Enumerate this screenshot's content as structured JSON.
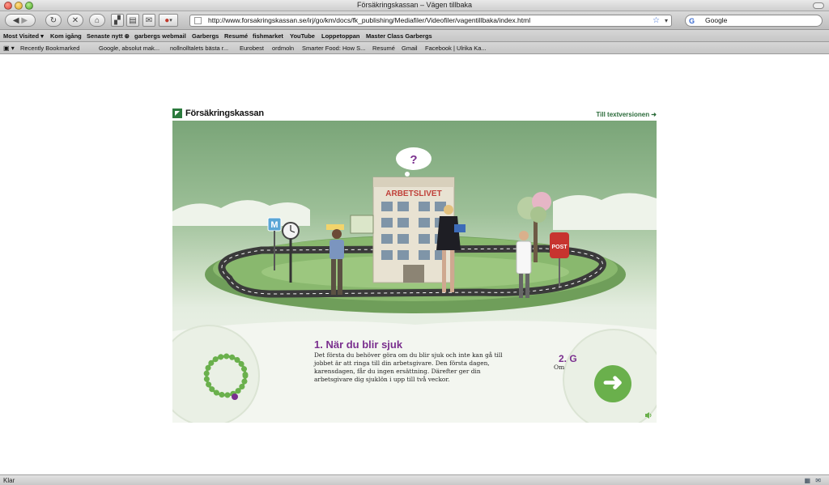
{
  "window": {
    "title": "Försäkringskassan – Vägen tillbaka"
  },
  "toolbar": {
    "url": "http://www.forsakringskassan.se/irj/go/km/docs/fk_publishing/Mediafiler/Videofiler/vagentillbaka/index.html",
    "search_value": "Google"
  },
  "bookmarks": {
    "row1": [
      "Most Visited ▾",
      "Kom igång",
      "Senaste nytt ⊛",
      "garbergs webmail",
      "Garbergs",
      "Resumé",
      "fishmarket",
      "YouTube",
      "Loppetoppan",
      "Master Class Garbergs"
    ],
    "row2": [
      "Recently Bookmarked",
      "Google, absolut mak...",
      "nollnolltalets bästa r...",
      "Eurobest",
      "ordmoln",
      "Smarter Food: How S...",
      "Resumé",
      "Gmail",
      "Facebook | Ulrika Ka..."
    ]
  },
  "page": {
    "logo_text": "Försäkringskassan",
    "text_version_link": "Till textversionen ➜",
    "scene": {
      "building_sign": "ARBETSLIVET",
      "thought_bubble": "?",
      "station_sign": "M",
      "mailbox_label": "POST"
    },
    "step": {
      "title": "1. När du blir sjuk",
      "body": "Det första du behöver göra om du blir sjuk och inte kan gå till jobbet är att ringa till din arbetsgivare. Den första dagen, karensdagen, får du ingen ersättning. Därefter ger din arbetsgivare dig sjuklön i upp till två veckor."
    },
    "next_step": {
      "title_fragment": "2. G",
      "body_fragment": "Om"
    },
    "next_button_glyph": "➜"
  },
  "status": {
    "text": "Klar"
  },
  "colors": {
    "brand_green": "#2b7a3d",
    "accent_purple": "#7a2f8e",
    "button_green": "#6ab04c"
  }
}
